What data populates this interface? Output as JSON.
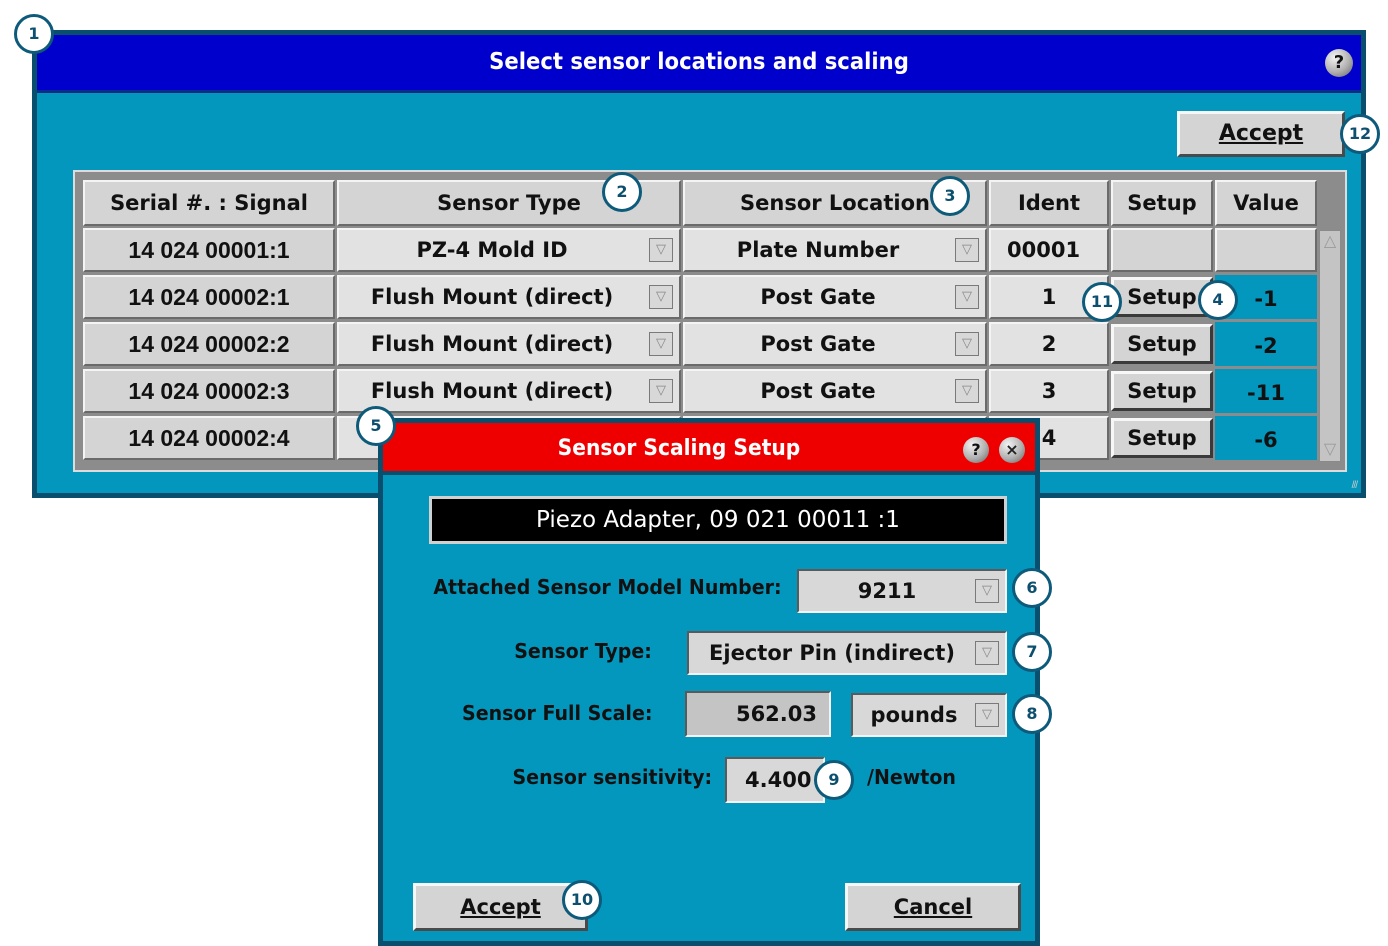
{
  "main_window": {
    "title": "Select sensor locations and scaling",
    "help_icon": "?",
    "accept_label": "Accept",
    "table": {
      "headers": [
        "Serial #. : Signal",
        "Sensor Type",
        "Sensor Location",
        "Ident",
        "Setup",
        "Value"
      ],
      "rows": [
        {
          "serial": "14 024 00001:1",
          "type": "PZ-4 Mold ID",
          "location": "Plate Number",
          "ident": "00001",
          "setup": "",
          "value": ""
        },
        {
          "serial": "14 024 00002:1",
          "type": "Flush Mount (direct)",
          "location": "Post Gate",
          "ident": "1",
          "setup": "Setup",
          "value": "-1"
        },
        {
          "serial": "14 024 00002:2",
          "type": "Flush Mount (direct)",
          "location": "Post Gate",
          "ident": "2",
          "setup": "Setup",
          "value": "-2"
        },
        {
          "serial": "14 024 00002:3",
          "type": "Flush Mount (direct)",
          "location": "Post Gate",
          "ident": "3",
          "setup": "Setup",
          "value": "-11"
        },
        {
          "serial": "14 024 00002:4",
          "type": "",
          "location": "",
          "ident": "4",
          "setup": "Setup",
          "value": "-6"
        }
      ]
    }
  },
  "dialog": {
    "title": "Sensor Scaling Setup",
    "help_icon": "?",
    "close_icon": "×",
    "adapter": "Piezo Adapter, 09 021 00011 :1",
    "model_label": "Attached Sensor Model Number:",
    "model_value": "9211",
    "type_label": "Sensor Type:",
    "type_value": "Ejector Pin (indirect)",
    "full_scale_label": "Sensor Full Scale:",
    "full_scale_value": "562.03",
    "units_value": "pounds",
    "sensitivity_label": "Sensor sensitivity:",
    "sensitivity_value": "4.400",
    "sensitivity_units": "/Newton",
    "accept_label": "Accept",
    "cancel_label": "Cancel"
  },
  "callouts": [
    "1",
    "2",
    "3",
    "4",
    "5",
    "6",
    "7",
    "8",
    "9",
    "10",
    "11",
    "12"
  ]
}
